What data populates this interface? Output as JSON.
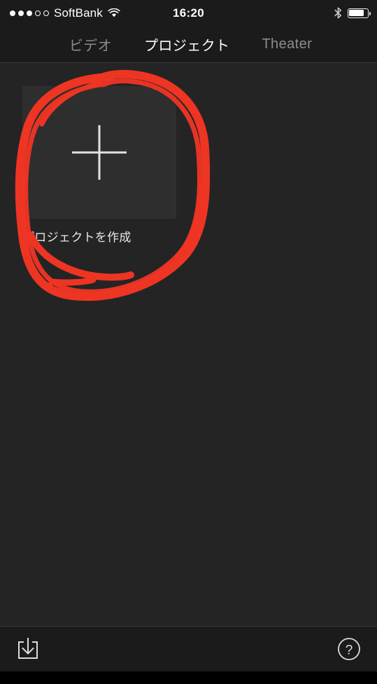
{
  "status_bar": {
    "signal_dots_filled": 3,
    "signal_dots_total": 5,
    "carrier": "SoftBank",
    "wifi_icon": "wifi-icon",
    "time": "16:20",
    "bluetooth_icon": "bluetooth-icon",
    "battery_icon": "battery-icon",
    "battery_percent": 72
  },
  "tab_bar": {
    "tabs": [
      {
        "label": "ビデオ",
        "active": false
      },
      {
        "label": "プロジェクト",
        "active": true
      },
      {
        "label": "Theater",
        "active": false
      }
    ]
  },
  "content": {
    "create_card": {
      "icon": "plus-icon",
      "label": "プロジェクトを作成"
    }
  },
  "annotation": {
    "type": "hand-drawn-circle",
    "color": "#ee3524",
    "target": "create-project-card"
  },
  "bottom_bar": {
    "import_icon": "import-download-icon",
    "help_icon": "help-question-icon"
  },
  "colors": {
    "app_background": "#242424",
    "bar_background": "#1b1b1b",
    "thumbnail_background": "#2e2e2e",
    "active_tab_text": "#ffffff",
    "inactive_tab_text": "#8d8d8d",
    "annotation_red": "#ee3524"
  }
}
